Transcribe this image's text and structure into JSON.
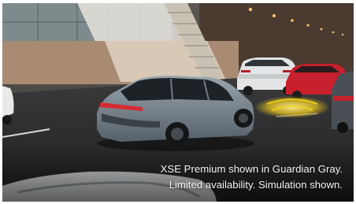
{
  "caption": {
    "line1": "XSE Premium shown in Guardian Gray.",
    "line2": "Limited availability. Simulation shown."
  },
  "colors": {
    "car_main": "#7c8891",
    "car_red": "#c8202c",
    "car_white": "#e2e4e6",
    "projection_light": "#f5d21a",
    "tunnel_lights": "#f7c66a"
  }
}
